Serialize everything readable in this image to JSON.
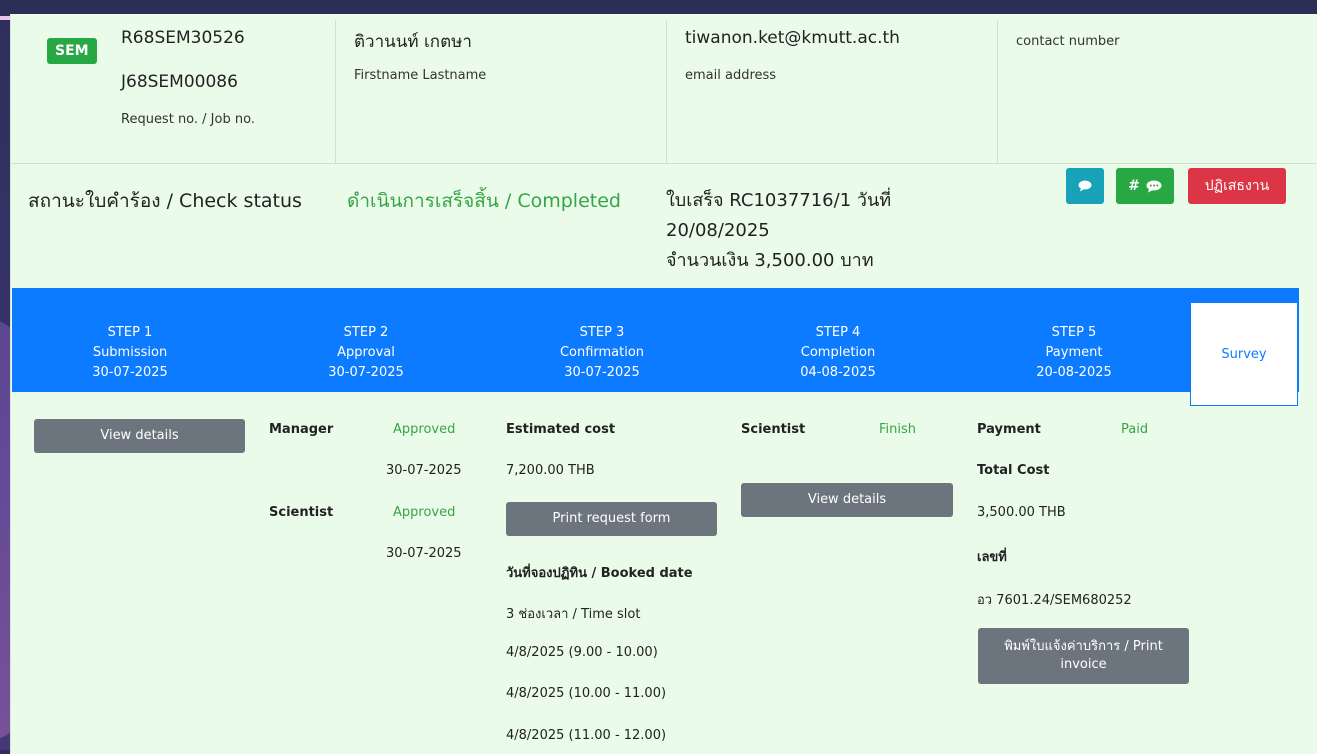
{
  "header": {
    "badge": "SEM",
    "request_no": "R68SEM30526",
    "job_no": "J68SEM00086",
    "request_caption": "Request no. / Job no.",
    "name": "ติวานนท์ เกตษา",
    "name_caption": "Firstname Lastname",
    "email": "tiwanon.ket@kmutt.ac.th",
    "email_caption": "email address",
    "contact_caption": "contact number"
  },
  "status": {
    "label": "สถานะใบคำร้อง / Check status",
    "value": "ดำเนินการเสร็จสิ้น / Completed",
    "receipt_line1": "ใบเสร็จ RC1037716/1 วันที่",
    "receipt_line2": "20/08/2025",
    "amount": "จำนวนเงิน 3,500.00 บาท",
    "chat_icon": "chat-icon",
    "hash_label": "#",
    "reject_label": "ปฏิเสธงาน",
    "colors": {
      "completed": "#36a548",
      "reject": "#dc3545",
      "info": "#17a2b8",
      "success": "#28a745"
    }
  },
  "steps": [
    {
      "step": "STEP 1",
      "name": "Submission",
      "date": "30-07-2025"
    },
    {
      "step": "STEP 2",
      "name": "Approval",
      "date": "30-07-2025"
    },
    {
      "step": "STEP 3",
      "name": "Confirmation",
      "date": "30-07-2025"
    },
    {
      "step": "STEP 4",
      "name": "Completion",
      "date": "04-08-2025"
    },
    {
      "step": "STEP 5",
      "name": "Payment",
      "date": "20-08-2025"
    }
  ],
  "survey_label": "Survey",
  "details": {
    "view_details_1": "View details",
    "manager_label": "Manager",
    "manager_status": "Approved",
    "manager_date": "30-07-2025",
    "scientist_label": "Scientist",
    "scientist_status": "Approved",
    "scientist_date": "30-07-2025",
    "estimated_cost_label": "Estimated cost",
    "estimated_cost": "7,200.00 THB",
    "print_request": "Print request form",
    "booked_date_label": "วันที่จองปฏิทิน / Booked date",
    "time_slot": "3 ช่องเวลา / Time slot",
    "slots": [
      "4/8/2025 (9.00 - 10.00)",
      "4/8/2025 (10.00 - 11.00)",
      "4/8/2025 (11.00 - 12.00)"
    ],
    "scientist4_label": "Scientist",
    "scientist4_status": "Finish",
    "view_details_2": "View details",
    "payment_label": "Payment",
    "payment_status": "Paid",
    "total_cost_label": "Total Cost",
    "total_cost": "3,500.00 THB",
    "doc_no_label": "เลขที่",
    "doc_no": "อว 7601.24/SEM680252",
    "print_invoice": "พิมพ์ใบแจ้งค่าบริการ / Print invoice"
  }
}
